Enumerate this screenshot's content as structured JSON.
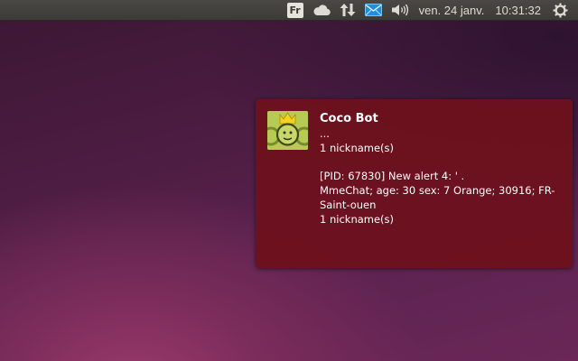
{
  "panel": {
    "keyboard_layout": "Fr",
    "date": "ven. 24 janv.",
    "time": "10:31:32",
    "icons": [
      "keyboard-layout-icon",
      "cloud-icon",
      "network-updown-icon",
      "mail-icon",
      "volume-icon",
      "session-gear-icon"
    ],
    "mail_color": "#1f8fdc"
  },
  "notification": {
    "title": "Coco Bot",
    "line1": "...",
    "line2": "1 nickname(s)",
    "alert": "[PID: 67830] New alert 4: ' .",
    "detail": "MmeChat; age: 30 sex: 7 Orange; 30916; FR-Saint-ouen",
    "footer": "1 nickname(s)",
    "background_color": "#6d111d",
    "icon_color": "#b8ca56"
  }
}
